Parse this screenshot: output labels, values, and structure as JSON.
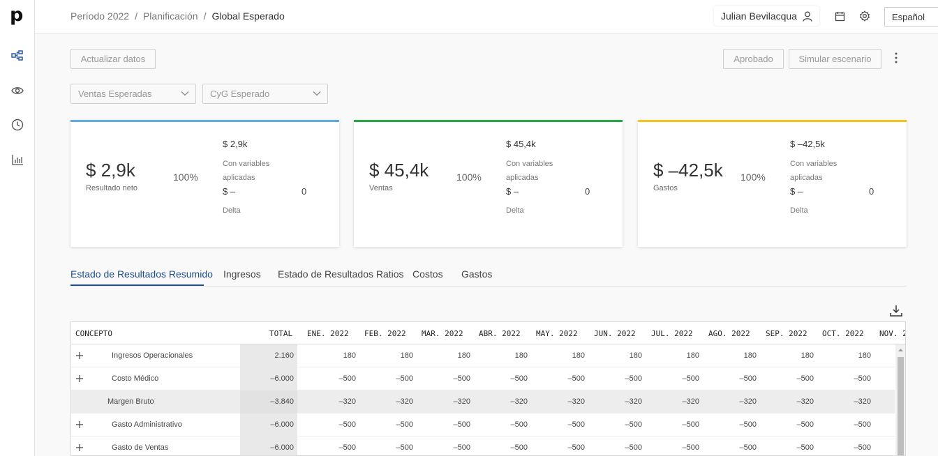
{
  "sidebar": {
    "logo": "p",
    "icons": [
      "hierarchy-icon",
      "eye-icon",
      "clock-icon",
      "bar-chart-icon"
    ]
  },
  "header": {
    "breadcrumb": [
      "Período 2022",
      "Planificación",
      "Global Esperado"
    ],
    "separator": "/",
    "user_name": "Julian Bevilacqua",
    "language": "Español"
  },
  "toolbar": {
    "refresh_label": "Actualizar datos",
    "approved_label": "Aprobado",
    "simulate_label": "Simular escenario",
    "select_sales": "Ventas Esperadas",
    "select_pl": "CyG Esperado"
  },
  "cards": [
    {
      "value": "$ 2,9k",
      "label": "Resultado neto",
      "percent": "100%",
      "applied_value": "$ 2,9k",
      "applied_label": "Con variables aplicadas",
      "delta_value": "$ –",
      "delta_number": "0",
      "delta_label": "Delta",
      "color": "#5dade2"
    },
    {
      "value": "$ 45,4k",
      "label": "Ventas",
      "percent": "100%",
      "applied_value": "$ 45,4k",
      "applied_label": "Con variables aplicadas",
      "delta_value": "$ –",
      "delta_number": "0",
      "delta_label": "Delta",
      "color": "#27a745"
    },
    {
      "value": "$ –42,5k",
      "label": "Gastos",
      "percent": "100%",
      "applied_value": "$ –42,5k",
      "applied_label": "Con variables aplicadas",
      "delta_value": "$ –",
      "delta_number": "0",
      "delta_label": "Delta",
      "color": "#f5c518"
    }
  ],
  "tabs": [
    "Estado de Resultados Resumido",
    "Ingresos",
    "Estado de Resultados Ratios",
    "Costos",
    "Gastos"
  ],
  "active_tab": "Estado de Resultados Resumido",
  "table": {
    "headers": [
      "CONCEPTO",
      "TOTAL",
      "ENE. 2022",
      "FEB. 2022",
      "MAR. 2022",
      "ABR. 2022",
      "MAY. 2022",
      "JUN. 2022",
      "JUL. 2022",
      "AGO. 2022",
      "SEP. 2022",
      "OCT. 2022",
      "NOV. 2"
    ],
    "rows": [
      {
        "concept": "Ingresos Operacionales",
        "expandable": true,
        "total": "2.160",
        "values": [
          "180",
          "180",
          "180",
          "180",
          "180",
          "180",
          "180",
          "180",
          "180",
          "180"
        ]
      },
      {
        "concept": "Costo Médico",
        "expandable": true,
        "total": "–6.000",
        "values": [
          "–500",
          "–500",
          "–500",
          "–500",
          "–500",
          "–500",
          "–500",
          "–500",
          "–500",
          "–500"
        ]
      },
      {
        "concept": "Margen Bruto",
        "expandable": false,
        "total": "–3.840",
        "values": [
          "–320",
          "–320",
          "–320",
          "–320",
          "–320",
          "–320",
          "–320",
          "–320",
          "–320",
          "–320"
        ]
      },
      {
        "concept": "Gasto Administrativo",
        "expandable": true,
        "total": "–6.000",
        "values": [
          "–500",
          "–500",
          "–500",
          "–500",
          "–500",
          "–500",
          "–500",
          "–500",
          "–500",
          "–500"
        ]
      },
      {
        "concept": "Gasto de Ventas",
        "expandable": true,
        "total": "–6.000",
        "values": [
          "–500",
          "–500",
          "–500",
          "–500",
          "–500",
          "–500",
          "–500",
          "–500",
          "–500",
          "–500"
        ]
      }
    ]
  }
}
